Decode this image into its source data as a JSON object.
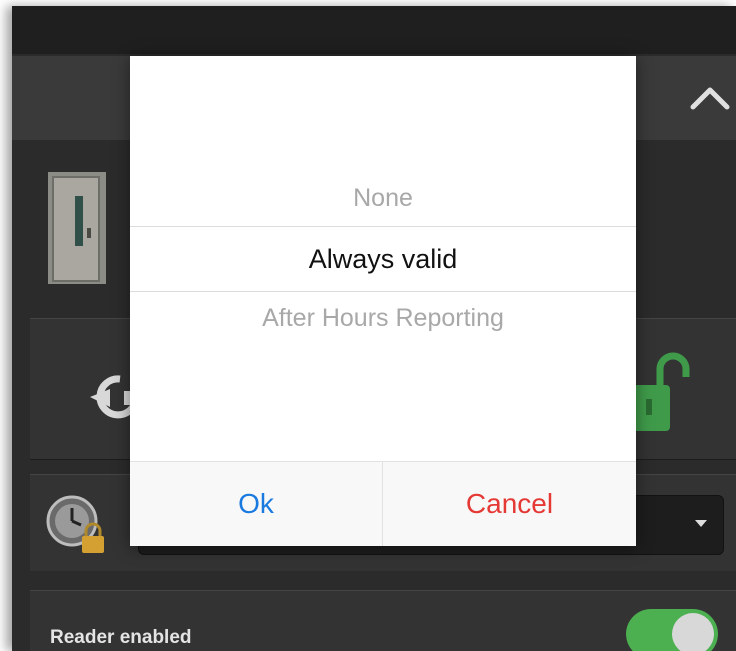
{
  "picker": {
    "options": [
      "None",
      "Always valid",
      "After Hours Reporting"
    ],
    "selected_index": 1,
    "ok_label": "Ok",
    "cancel_label": "Cancel"
  },
  "reader": {
    "label": "Reader enabled",
    "enabled": true
  },
  "icons": {
    "header": "chevron-up-icon",
    "door": "door-icon",
    "reset": "reset-icon",
    "unlock": "unlock-icon",
    "schedule": "schedule-lock-icon",
    "dropdown": "dropdown-arrow-icon"
  },
  "colors": {
    "ok": "#1a7ae0",
    "cancel": "#e53935",
    "toggle_on": "#4caf50",
    "unlock": "#3f9b4a"
  }
}
